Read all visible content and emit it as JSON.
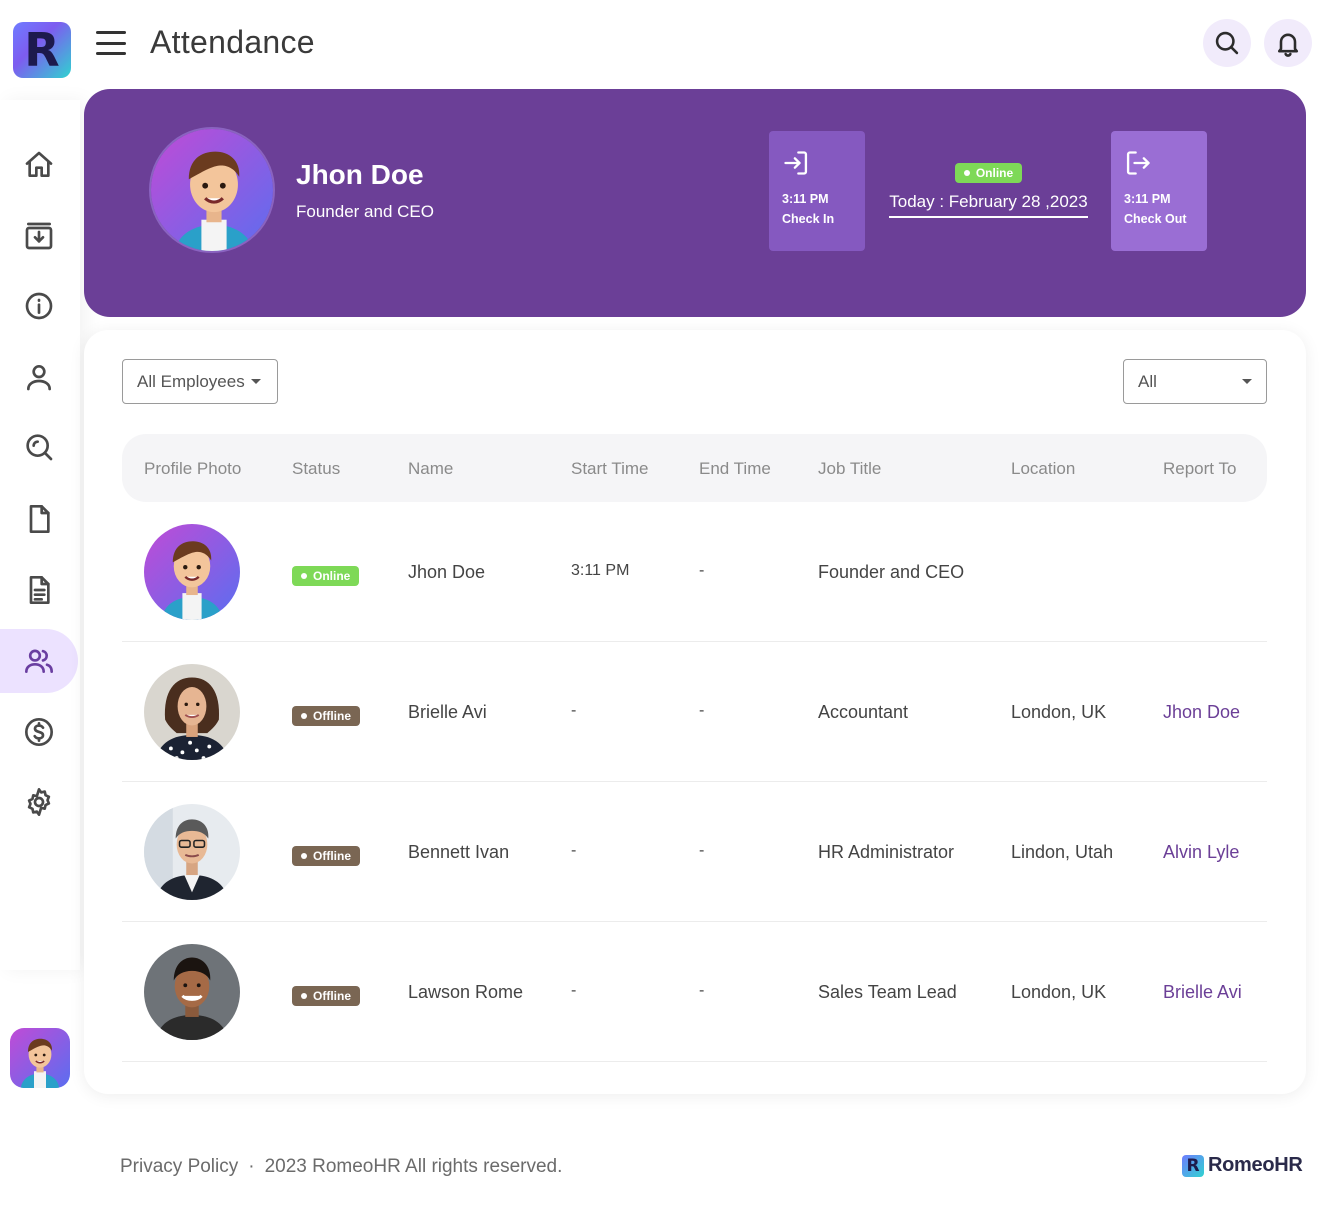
{
  "app": {
    "logo_letter": "R",
    "title": "Attendance"
  },
  "header": {
    "search_icon": "search-icon",
    "notification_icon": "bell-icon"
  },
  "sidebar": {
    "items": [
      {
        "name": "home",
        "icon": "home-icon",
        "active": false
      },
      {
        "name": "inbox",
        "icon": "inbox-download-icon",
        "active": false
      },
      {
        "name": "info",
        "icon": "info-icon",
        "active": false
      },
      {
        "name": "profile",
        "icon": "user-icon",
        "active": false
      },
      {
        "name": "search",
        "icon": "search-zoom-icon",
        "active": false
      },
      {
        "name": "document",
        "icon": "file-icon",
        "active": false
      },
      {
        "name": "report",
        "icon": "file-text-icon",
        "active": false
      },
      {
        "name": "attendance",
        "icon": "users-icon",
        "active": true
      },
      {
        "name": "payroll",
        "icon": "dollar-icon",
        "active": false
      },
      {
        "name": "settings",
        "icon": "gear-icon",
        "active": false
      }
    ]
  },
  "profile": {
    "name": "Jhon Doe",
    "role": "Founder and CEO",
    "status": "Online",
    "today": "Today : February 28 ,2023",
    "check_in": {
      "time": "3:11 PM",
      "label": "Check In"
    },
    "check_out": {
      "time": "3:11 PM",
      "label": "Check Out"
    }
  },
  "filters": {
    "employees": "All Employees",
    "status": "All"
  },
  "table": {
    "headers": [
      "Profile Photo",
      "Status",
      "Name",
      "Start Time",
      "End Time",
      "Job Title",
      "Location",
      "Report To"
    ],
    "rows": [
      {
        "status": "Online",
        "name": "Jhon Doe",
        "start": "3:11 PM",
        "end": "-",
        "job": "Founder and CEO",
        "location": "",
        "report_to": ""
      },
      {
        "status": "Offline",
        "name": "Brielle Avi",
        "start": "-",
        "end": "-",
        "job": "Accountant",
        "location": "London, UK",
        "report_to": "Jhon Doe"
      },
      {
        "status": "Offline",
        "name": "Bennett Ivan",
        "start": "-",
        "end": "-",
        "job": "HR Administrator",
        "location": "Lindon, Utah",
        "report_to": "Alvin Lyle"
      },
      {
        "status": "Offline",
        "name": "Lawson Rome",
        "start": "-",
        "end": "-",
        "job": "Sales Team Lead",
        "location": "London, UK",
        "report_to": "Brielle Avi"
      }
    ]
  },
  "footer": {
    "privacy": "Privacy Policy",
    "separator": "·",
    "copyright": "2023 RomeoHR All rights reserved.",
    "brand_letter": "R",
    "brand_name": "RomeoHR"
  },
  "colors": {
    "primary": "#6b3f97",
    "online": "#7ed957",
    "offline": "#7a6653",
    "active_nav": "#ece2ff"
  }
}
